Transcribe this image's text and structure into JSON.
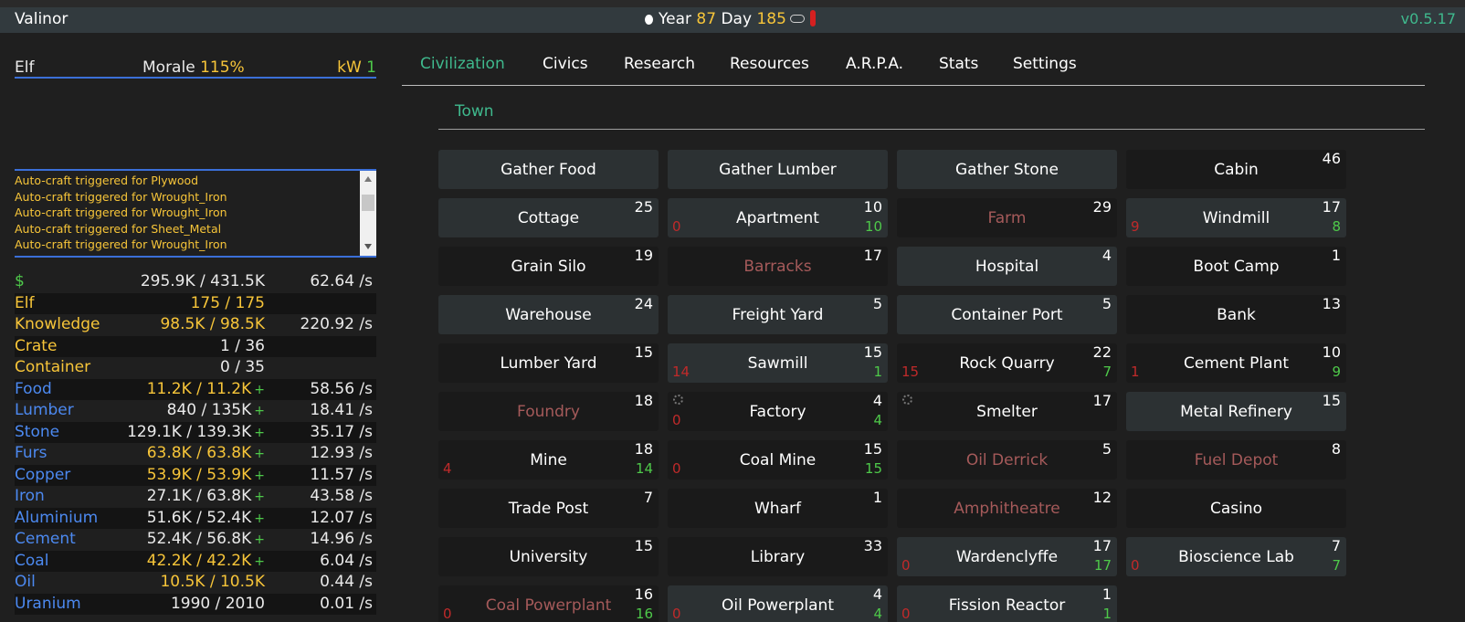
{
  "topbar": {
    "title": "Valinor",
    "year_label": "Year",
    "year": "87",
    "day_label": "Day",
    "day": "185",
    "version": "v0.5.17"
  },
  "race": {
    "name": "Elf",
    "morale_label": "Morale",
    "morale_value": "115%",
    "power_label": "kW",
    "power_value": "1"
  },
  "message_log": [
    "Auto-craft triggered for Plywood",
    "Auto-craft triggered for Wrought_Iron",
    "Auto-craft triggered for Wrought_Iron",
    "Auto-craft triggered for Sheet_Metal",
    "Auto-craft triggered for Wrought_Iron",
    "Auto-craft triggered for Plywood"
  ],
  "resources": [
    {
      "name": "$",
      "name_color": "green",
      "amount": "295.9K / 431.5K",
      "full": false,
      "plus": "",
      "rate": "62.64 /s"
    },
    {
      "name": "Elf",
      "name_color": "yellow",
      "amount": "175 / 175",
      "full": true,
      "plus": "",
      "rate": ""
    },
    {
      "name": "Knowledge",
      "name_color": "yellow",
      "amount": "98.5K / 98.5K",
      "full": true,
      "plus": "",
      "rate": "220.92 /s"
    },
    {
      "name": "Crate",
      "name_color": "yellow",
      "amount": "1 / 36",
      "full": false,
      "plus": "",
      "rate": ""
    },
    {
      "name": "Container",
      "name_color": "yellow",
      "amount": "0 / 35",
      "full": false,
      "plus": "",
      "rate": ""
    },
    {
      "name": "Food",
      "name_color": "blue",
      "amount": "11.2K / 11.2K",
      "full": true,
      "plus": "+",
      "rate": "58.56 /s"
    },
    {
      "name": "Lumber",
      "name_color": "blue",
      "amount": "840 / 135K",
      "full": false,
      "plus": "+",
      "rate": "18.41 /s"
    },
    {
      "name": "Stone",
      "name_color": "blue",
      "amount": "129.1K / 139.3K",
      "full": false,
      "plus": "+",
      "rate": "35.17 /s"
    },
    {
      "name": "Furs",
      "name_color": "blue",
      "amount": "63.8K / 63.8K",
      "full": true,
      "plus": "+",
      "rate": "12.93 /s"
    },
    {
      "name": "Copper",
      "name_color": "blue",
      "amount": "53.9K / 53.9K",
      "full": true,
      "plus": "+",
      "rate": "11.57 /s"
    },
    {
      "name": "Iron",
      "name_color": "blue",
      "amount": "27.1K / 63.8K",
      "full": false,
      "plus": "+",
      "rate": "43.58 /s"
    },
    {
      "name": "Aluminium",
      "name_color": "blue",
      "amount": "51.6K / 52.4K",
      "full": false,
      "plus": "+",
      "rate": "12.07 /s"
    },
    {
      "name": "Cement",
      "name_color": "blue",
      "amount": "52.4K / 56.8K",
      "full": false,
      "plus": "+",
      "rate": "14.96 /s"
    },
    {
      "name": "Coal",
      "name_color": "blue",
      "amount": "42.2K / 42.2K",
      "full": true,
      "plus": "+",
      "rate": "6.04 /s"
    },
    {
      "name": "Oil",
      "name_color": "blue",
      "amount": "10.5K / 10.5K",
      "full": true,
      "plus": "",
      "rate": "0.44 /s"
    },
    {
      "name": "Uranium",
      "name_color": "blue",
      "amount": "1990 / 2010",
      "full": false,
      "plus": "",
      "rate": "0.01 /s"
    }
  ],
  "tabs": [
    {
      "label": "Civilization",
      "active": true
    },
    {
      "label": "Civics",
      "active": false
    },
    {
      "label": "Research",
      "active": false
    },
    {
      "label": "Resources",
      "active": false
    },
    {
      "label": "A.R.P.A.",
      "active": false
    },
    {
      "label": "Stats",
      "active": false
    },
    {
      "label": "Settings",
      "active": false
    }
  ],
  "subtab": "Town",
  "buildings": [
    {
      "label": "Gather Food",
      "count": "",
      "on": "",
      "off": "",
      "affordable": true,
      "bg": "light",
      "gear": false
    },
    {
      "label": "Gather Lumber",
      "count": "",
      "on": "",
      "off": "",
      "affordable": true,
      "bg": "light",
      "gear": false
    },
    {
      "label": "Gather Stone",
      "count": "",
      "on": "",
      "off": "",
      "affordable": true,
      "bg": "light",
      "gear": false
    },
    {
      "label": "Cabin",
      "count": "46",
      "on": "",
      "off": "",
      "affordable": true,
      "bg": "dim",
      "gear": false
    },
    {
      "label": "Cottage",
      "count": "25",
      "on": "",
      "off": "",
      "affordable": true,
      "bg": "light",
      "gear": false
    },
    {
      "label": "Apartment",
      "count": "10",
      "on": "10",
      "off": "0",
      "affordable": true,
      "bg": "light",
      "gear": false
    },
    {
      "label": "Farm",
      "count": "29",
      "on": "",
      "off": "",
      "affordable": false,
      "bg": "dim",
      "gear": false
    },
    {
      "label": "Windmill",
      "count": "17",
      "on": "8",
      "off": "9",
      "affordable": true,
      "bg": "light",
      "gear": false
    },
    {
      "label": "Grain Silo",
      "count": "19",
      "on": "",
      "off": "",
      "affordable": true,
      "bg": "dim",
      "gear": false
    },
    {
      "label": "Barracks",
      "count": "17",
      "on": "",
      "off": "",
      "affordable": false,
      "bg": "dim",
      "gear": false
    },
    {
      "label": "Hospital",
      "count": "4",
      "on": "",
      "off": "",
      "affordable": true,
      "bg": "light",
      "gear": false
    },
    {
      "label": "Boot Camp",
      "count": "1",
      "on": "",
      "off": "",
      "affordable": true,
      "bg": "dim",
      "gear": false
    },
    {
      "label": "Warehouse",
      "count": "24",
      "on": "",
      "off": "",
      "affordable": true,
      "bg": "light",
      "gear": false
    },
    {
      "label": "Freight Yard",
      "count": "5",
      "on": "",
      "off": "",
      "affordable": true,
      "bg": "light",
      "gear": false
    },
    {
      "label": "Container Port",
      "count": "5",
      "on": "",
      "off": "",
      "affordable": true,
      "bg": "light",
      "gear": false
    },
    {
      "label": "Bank",
      "count": "13",
      "on": "",
      "off": "",
      "affordable": true,
      "bg": "dim",
      "gear": false
    },
    {
      "label": "Lumber Yard",
      "count": "15",
      "on": "",
      "off": "",
      "affordable": true,
      "bg": "dim",
      "gear": false
    },
    {
      "label": "Sawmill",
      "count": "15",
      "on": "1",
      "off": "14",
      "affordable": true,
      "bg": "light",
      "gear": false
    },
    {
      "label": "Rock Quarry",
      "count": "22",
      "on": "7",
      "off": "15",
      "affordable": true,
      "bg": "dim",
      "gear": false
    },
    {
      "label": "Cement Plant",
      "count": "10",
      "on": "9",
      "off": "1",
      "affordable": true,
      "bg": "dim",
      "gear": false
    },
    {
      "label": "Foundry",
      "count": "18",
      "on": "",
      "off": "",
      "affordable": false,
      "bg": "dim",
      "gear": false
    },
    {
      "label": "Factory",
      "count": "4",
      "on": "4",
      "off": "0",
      "affordable": true,
      "bg": "dim",
      "gear": true
    },
    {
      "label": "Smelter",
      "count": "17",
      "on": "",
      "off": "",
      "affordable": true,
      "bg": "dim",
      "gear": true
    },
    {
      "label": "Metal Refinery",
      "count": "15",
      "on": "",
      "off": "",
      "affordable": true,
      "bg": "light",
      "gear": false
    },
    {
      "label": "Mine",
      "count": "18",
      "on": "14",
      "off": "4",
      "affordable": true,
      "bg": "dim",
      "gear": false
    },
    {
      "label": "Coal Mine",
      "count": "15",
      "on": "15",
      "off": "0",
      "affordable": true,
      "bg": "dim",
      "gear": false
    },
    {
      "label": "Oil Derrick",
      "count": "5",
      "on": "",
      "off": "",
      "affordable": false,
      "bg": "dim",
      "gear": false
    },
    {
      "label": "Fuel Depot",
      "count": "8",
      "on": "",
      "off": "",
      "affordable": false,
      "bg": "dim",
      "gear": false
    },
    {
      "label": "Trade Post",
      "count": "7",
      "on": "",
      "off": "",
      "affordable": true,
      "bg": "dim",
      "gear": false
    },
    {
      "label": "Wharf",
      "count": "1",
      "on": "",
      "off": "",
      "affordable": true,
      "bg": "dim",
      "gear": false
    },
    {
      "label": "Amphitheatre",
      "count": "12",
      "on": "",
      "off": "",
      "affordable": false,
      "bg": "dim",
      "gear": false
    },
    {
      "label": "Casino",
      "count": "",
      "on": "",
      "off": "",
      "affordable": true,
      "bg": "dim",
      "gear": false
    },
    {
      "label": "University",
      "count": "15",
      "on": "",
      "off": "",
      "affordable": true,
      "bg": "dim",
      "gear": false
    },
    {
      "label": "Library",
      "count": "33",
      "on": "",
      "off": "",
      "affordable": true,
      "bg": "dim",
      "gear": false
    },
    {
      "label": "Wardenclyffe",
      "count": "17",
      "on": "17",
      "off": "0",
      "affordable": true,
      "bg": "light",
      "gear": false
    },
    {
      "label": "Bioscience Lab",
      "count": "7",
      "on": "7",
      "off": "0",
      "affordable": true,
      "bg": "light",
      "gear": false
    },
    {
      "label": "Coal Powerplant",
      "count": "16",
      "on": "16",
      "off": "0",
      "affordable": false,
      "bg": "dim",
      "gear": false
    },
    {
      "label": "Oil Powerplant",
      "count": "4",
      "on": "4",
      "off": "0",
      "affordable": true,
      "bg": "light",
      "gear": false
    },
    {
      "label": "Fission Reactor",
      "count": "1",
      "on": "1",
      "off": "0",
      "affordable": true,
      "bg": "light",
      "gear": false
    }
  ],
  "colors": {
    "accent": "#3fb98d",
    "highlight": "#f7c539",
    "positive": "#4ec94a",
    "negative": "#c02a2a",
    "resource_blue": "#4c89f0",
    "border_blue": "#3b6fd8"
  }
}
